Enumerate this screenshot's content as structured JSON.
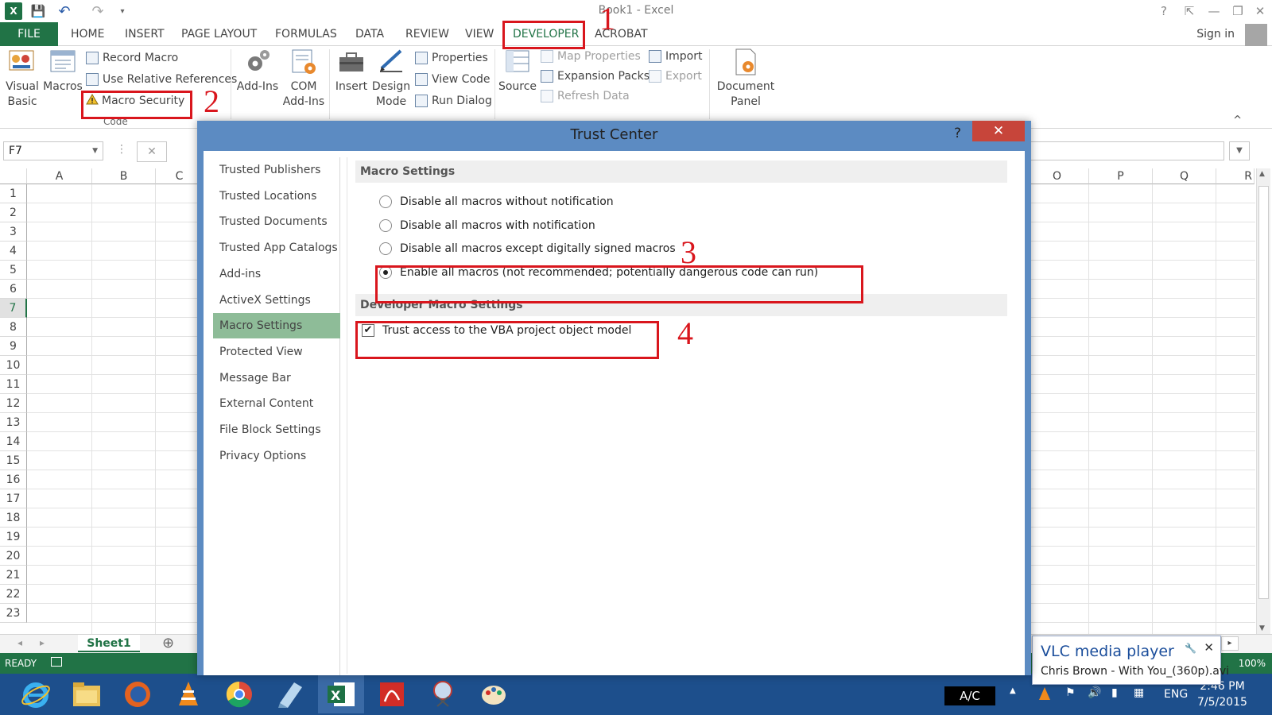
{
  "window": {
    "title": "Book1 - Excel",
    "help": "?",
    "restore_ribbon": "⇱",
    "minimize": "—",
    "maximize": "❐",
    "close": "✕"
  },
  "qat": {
    "app_icon": "X",
    "save": "💾",
    "undo": "↶",
    "redo": "↷",
    "more": "▾"
  },
  "ribbon": {
    "file_label": "FILE",
    "tabs": [
      "HOME",
      "INSERT",
      "PAGE LAYOUT",
      "FORMULAS",
      "DATA",
      "REVIEW",
      "VIEW",
      "DEVELOPER",
      "ACROBAT"
    ],
    "sign_in": "Sign in",
    "code": {
      "visual_basic": [
        "Visual",
        "Basic"
      ],
      "macros": "Macros",
      "record_macro": "Record Macro",
      "relative_refs": "Use Relative References",
      "macro_security": "Macro Security",
      "label": "Code"
    },
    "addins": {
      "addins": "Add-Ins",
      "com_addins": [
        "COM",
        "Add-Ins"
      ]
    },
    "controls": {
      "insert": "Insert",
      "design_mode": [
        "Design",
        "Mode"
      ],
      "properties": "Properties",
      "view_code": "View Code",
      "run_dialog": "Run Dialog"
    },
    "xml": {
      "source": "Source",
      "map_properties": "Map Properties",
      "expansion_packs": "Expansion Packs",
      "refresh_data": "Refresh Data",
      "import": "Import",
      "export": "Export"
    },
    "modify": {
      "document_panel": [
        "Document",
        "Panel"
      ]
    },
    "collapse": "^"
  },
  "formula_bar": {
    "name_box": "F7",
    "cancel": "✕",
    "enter": "✓",
    "fx_sep": "⋮"
  },
  "grid": {
    "columns_left": [
      "A",
      "B",
      "C"
    ],
    "columns_right": [
      "O",
      "P",
      "Q",
      "R"
    ],
    "rows": [
      "1",
      "2",
      "3",
      "4",
      "5",
      "6",
      "7",
      "8",
      "9",
      "10",
      "11",
      "12",
      "13",
      "14",
      "15",
      "16",
      "17",
      "18",
      "19",
      "20",
      "21",
      "22",
      "23"
    ],
    "active_row": "7"
  },
  "sheets": {
    "tab": "Sheet1",
    "add": "⊕",
    "prev": "◂",
    "next": "▸"
  },
  "status": {
    "ready": "READY",
    "zoom": "100%"
  },
  "dialog": {
    "title": "Trust Center",
    "help": "?",
    "close": "✕",
    "nav": [
      "Trusted Publishers",
      "Trusted Locations",
      "Trusted Documents",
      "Trusted App Catalogs",
      "Add-ins",
      "ActiveX Settings",
      "Macro Settings",
      "Protected View",
      "Message Bar",
      "External Content",
      "File Block Settings",
      "Privacy Options"
    ],
    "selected_nav": "Macro Settings",
    "macro_section": "Macro Settings",
    "options": [
      "Disable all macros without notification",
      "Disable all macros with notification",
      "Disable all macros except digitally signed macros",
      "Enable all macros (not recommended; potentially dangerous code can run)"
    ],
    "selected_option": 3,
    "dev_section": "Developer Macro Settings",
    "trust_vba": "Trust access to the VBA project object model",
    "trust_vba_checked": true
  },
  "annotations": [
    "1",
    "2",
    "3",
    "4"
  ],
  "taskbar": {
    "ac_label": "A/C",
    "lang": "ENG",
    "time": "2:46 PM",
    "date": "7/5/2015",
    "tray_up": "▲"
  },
  "notification": {
    "title": "VLC media player",
    "text": "Chris Brown - With You_(360p).avi",
    "pin": "🔧",
    "close": "✕"
  },
  "colors": {
    "excel_green": "#217346",
    "annotation_red": "#d9161d",
    "dialog_frame": "#5c8bc2",
    "selected_nav": "#8ebc98"
  }
}
